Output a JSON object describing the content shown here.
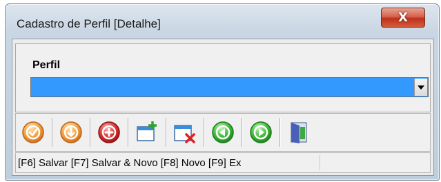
{
  "window": {
    "title": "Cadastro de Perfil [Detalhe]",
    "close_glyph": "X"
  },
  "form": {
    "perfil_label": "Perfil",
    "perfil_value": ""
  },
  "toolbar": {
    "buttons": [
      {
        "icon": "check-circle-icon",
        "color": "#f2a03d"
      },
      {
        "icon": "download-circle-icon",
        "color": "#f2a03d"
      },
      {
        "icon": "add-circle-icon",
        "color": "#d42a2a"
      },
      {
        "icon": "new-window-icon",
        "color": "#3a8ed6"
      },
      {
        "icon": "close-window-icon",
        "color": "#3a8ed6"
      },
      {
        "icon": "previous-circle-icon",
        "color": "#3cb43c"
      },
      {
        "icon": "next-circle-icon",
        "color": "#3cb43c"
      },
      {
        "icon": "exit-door-icon",
        "color": "#4a5fb8"
      }
    ]
  },
  "status": {
    "text": "[F6] Salvar [F7] Salvar & Novo [F8] Novo [F9] Ex"
  },
  "colors": {
    "selection": "#3399ff",
    "orange": "#f2a03d",
    "red": "#d42a2a",
    "green": "#3cb43c",
    "blue": "#3a8ed6"
  }
}
